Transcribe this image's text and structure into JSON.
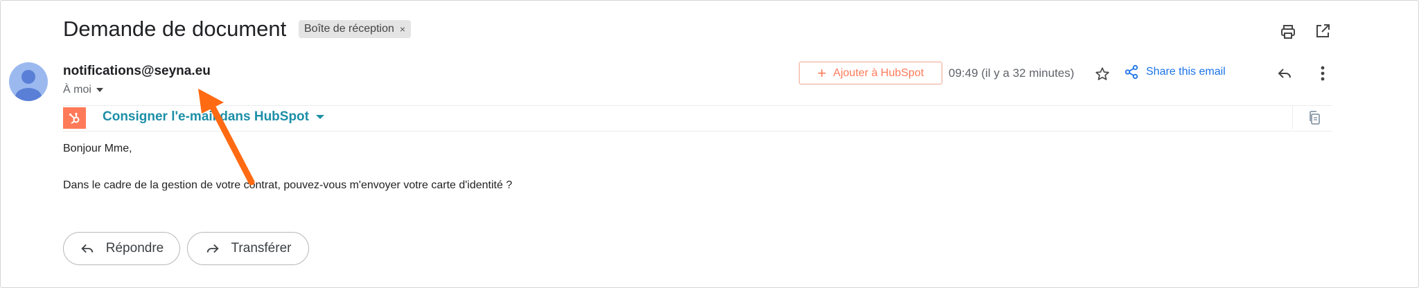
{
  "header": {
    "subject": "Demande de document",
    "label": "Boîte de réception",
    "label_remove": "×"
  },
  "toolbar": {
    "print_icon": "printer-icon",
    "open_new_icon": "open-in-new-window-icon"
  },
  "message": {
    "avatar_icon": "default-person-avatar",
    "sender": "notifications@seyna.eu",
    "recipient": "À moi",
    "time": "09:49 (il y a 32 minutes)",
    "greeting": "Bonjour Mme,",
    "body": "Dans le cadre de la gestion de votre contrat, pouvez-vous m'envoyer votre carte d'identité ?"
  },
  "hubspot": {
    "add_label": "Ajouter à HubSpot",
    "add_icon": "plus-icon",
    "log_label": "Consigner l'e-mail dans HubSpot",
    "logo_icon": "hubspot-sprocket-icon",
    "copy_icon": "copy-icon",
    "share_label": "Share this email",
    "share_icon": "share-icon"
  },
  "actions": {
    "reply_label": "Répondre",
    "forward_label": "Transférer"
  },
  "annotation": {
    "color": "#ff6a13",
    "icon": "orange-arrow-pointer"
  },
  "colors": {
    "hubspot_orange": "#ff7a59",
    "hubspot_teal": "#1c8fa7",
    "link_blue": "#1a73e8",
    "avatar_blue": "#9bb9ef"
  }
}
